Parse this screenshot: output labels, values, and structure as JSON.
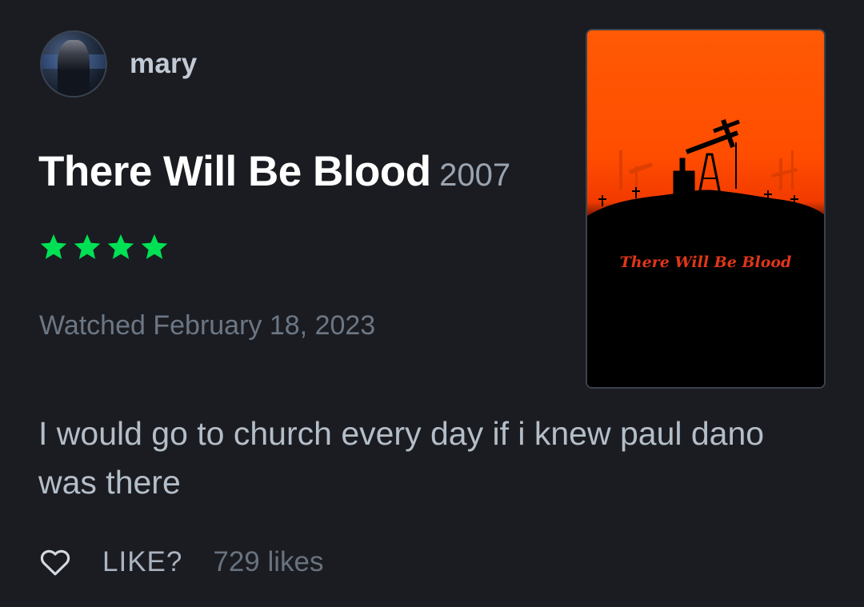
{
  "author": {
    "username": "mary",
    "avatar_icon": "user-avatar"
  },
  "film": {
    "title": "There Will Be Blood",
    "year": "2007",
    "poster_title": "There Will Be Blood"
  },
  "rating": {
    "stars": 4,
    "max": 5,
    "color": "#00e054"
  },
  "watched_text": "Watched February 18, 2023",
  "review_text": "I would go to church every day if i knew paul dano was there",
  "actions": {
    "like_icon": "heart-icon",
    "like_label": "LIKE?",
    "likes_count": "729 likes"
  },
  "colors": {
    "background": "#1b1c21",
    "title": "#ffffff",
    "muted": "#6c7785",
    "poster_orange": "#ff5a05"
  }
}
